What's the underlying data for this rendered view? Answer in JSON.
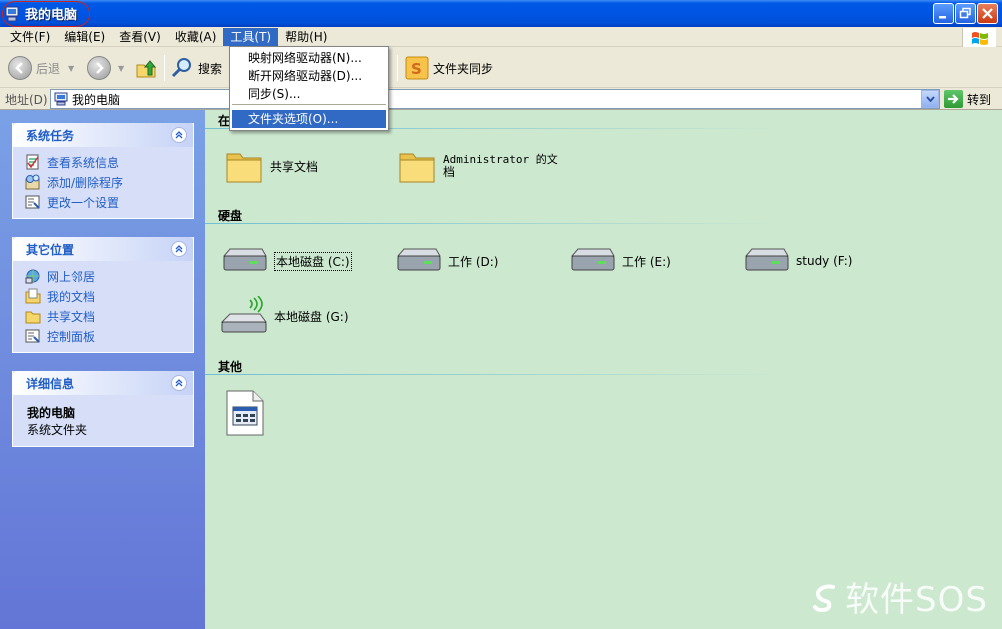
{
  "window": {
    "title": "我的电脑"
  },
  "menubar": {
    "items": [
      "文件(F)",
      "编辑(E)",
      "查看(V)",
      "收藏(A)",
      "工具(T)",
      "帮助(H)"
    ],
    "active_index": 4
  },
  "toolbar": {
    "back": "后退",
    "search": "搜索",
    "sync": "文件夹同步"
  },
  "address": {
    "label": "地址(D)",
    "value": "我的电脑",
    "go": "转到"
  },
  "tools_menu": {
    "items": [
      "映射网络驱动器(N)...",
      "断开网络驱动器(D)...",
      "同步(S)...",
      "文件夹选项(O)..."
    ],
    "highlighted_index": 3
  },
  "left_panel": {
    "system_tasks": {
      "title": "系统任务",
      "items": [
        "查看系统信息",
        "添加/删除程序",
        "更改一个设置"
      ]
    },
    "other_places": {
      "title": "其它位置",
      "items": [
        "网上邻居",
        "我的文档",
        "共享文档",
        "控制面板"
      ]
    },
    "details": {
      "title": "详细信息",
      "name": "我的电脑",
      "type": "系统文件夹"
    }
  },
  "content": {
    "group_stored": {
      "title": "在"
    },
    "folders": [
      "共享文档",
      "Administrator 的文",
      "档"
    ],
    "group_hdd": {
      "title": "硬盘"
    },
    "drives": [
      "本地磁盘 (C:)",
      "工作 (D:)",
      "工作 (E:)",
      "study (F:)",
      "本地磁盘 (G:)"
    ],
    "group_other": {
      "title": "其他"
    }
  },
  "watermark": "软件SOS"
}
